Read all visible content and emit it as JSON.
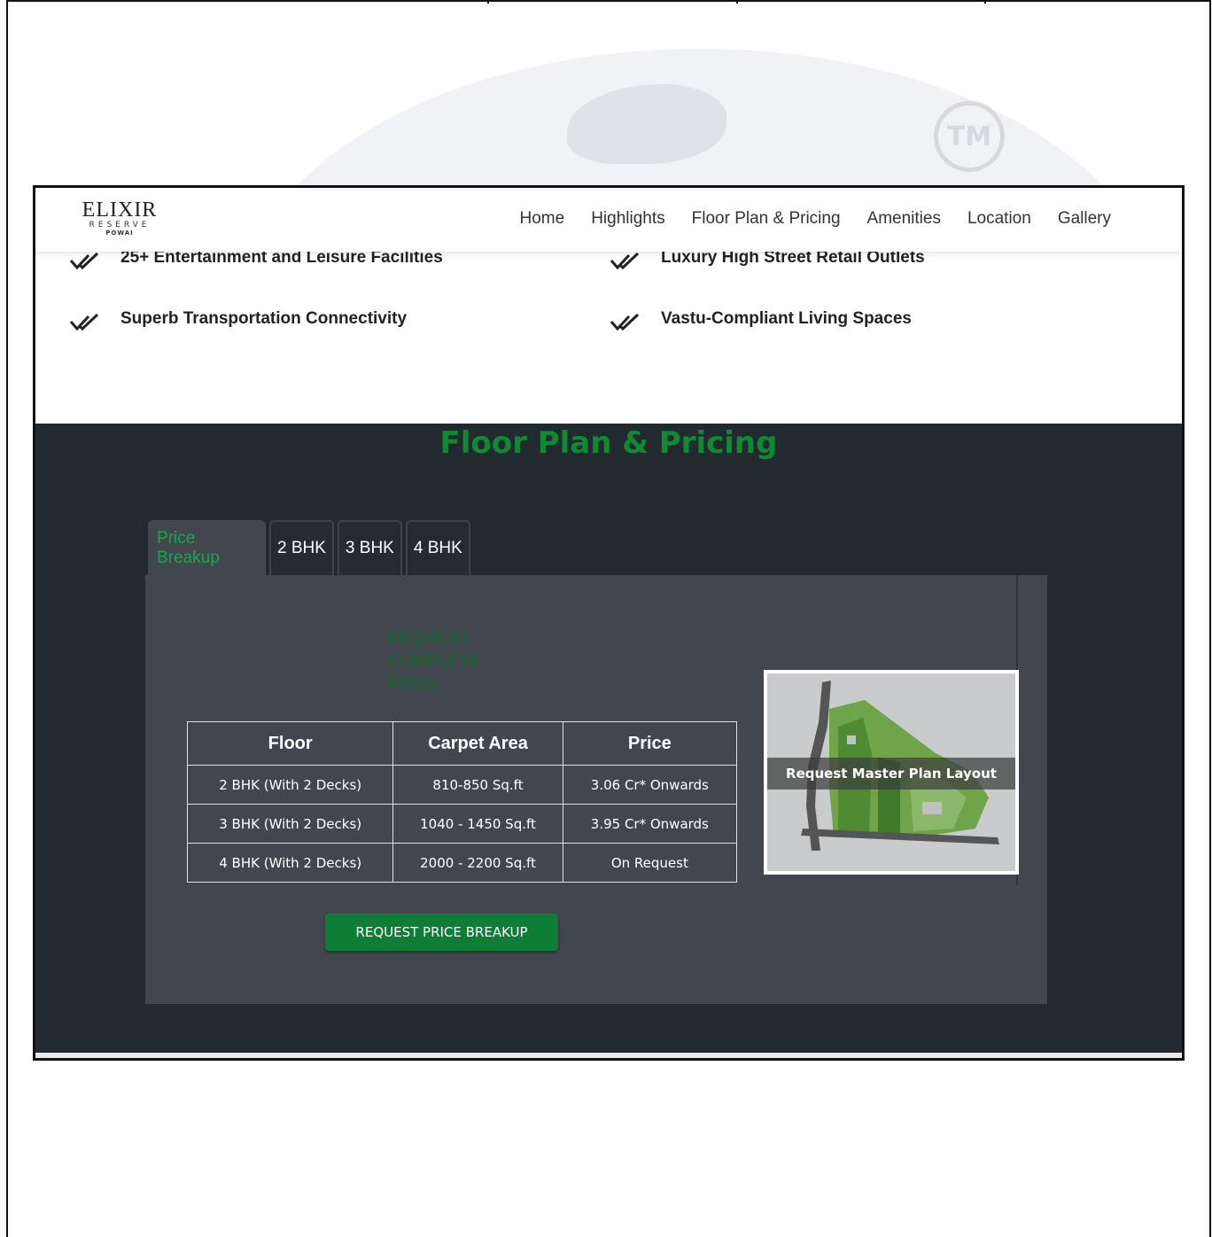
{
  "brand": {
    "name": "ELIXIR",
    "sub": "RESERVE",
    "loc": "POWAI"
  },
  "nav": [
    "Home",
    "Highlights",
    "Floor Plan & Pricing",
    "Amenities",
    "Location",
    "Gallery"
  ],
  "highlights": [
    "25+ Entertainment and Leisure Facilities",
    "Luxury High Street Retail Outlets",
    "Superb Transportation Connectivity",
    "Vastu-Compliant Living Spaces"
  ],
  "section_title": "Floor Plan & Pricing",
  "tabs": [
    "Price Breakup",
    "2 BHK",
    "3 BHK",
    "4 BHK"
  ],
  "request_text": "REQUEST COMPLETE PRICE",
  "table": {
    "headers": [
      "Floor",
      "Carpet Area",
      "Price"
    ],
    "rows": [
      [
        "2 BHK (With 2 Decks)",
        "810-850 Sq.ft",
        "3.06 Cr* Onwards"
      ],
      [
        "3 BHK (With 2 Decks)",
        "1040 - 1450 Sq.ft",
        "3.95 Cr* Onwards"
      ],
      [
        "4 BHK (With 2 Decks)",
        "2000 - 2200 Sq.ft",
        "On Request"
      ]
    ]
  },
  "button_label": "REQUEST PRICE BREAKUP",
  "master_plan_label": "Request Master Plan Layout",
  "watermark": "TM",
  "colors": {
    "accent_green": "#0d8a32",
    "dark_bg": "#222a30",
    "panel_bg": "#41474d",
    "button_green": "#0f7d35"
  }
}
